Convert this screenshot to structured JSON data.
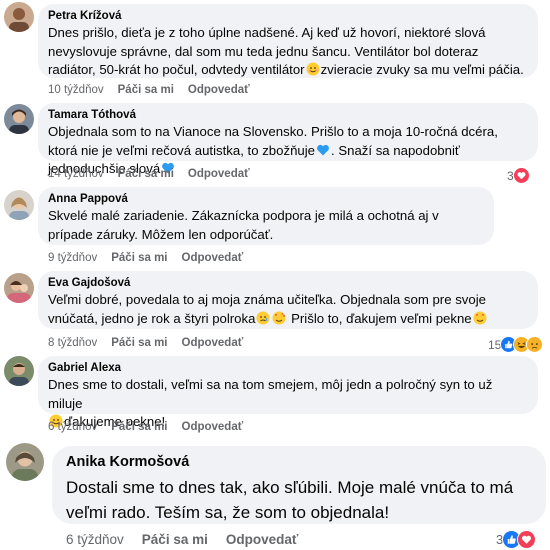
{
  "actions": {
    "like": "Páči sa mi",
    "reply": "Odpovedať"
  },
  "comments": [
    {
      "author": "Petra Krížová",
      "text_parts": [
        "Dnes prišlo, dieťa je z toho úplne nadšené. Aj keď už hovorí, niektoré slová nevyslovuje správne, dal som mu teda jednu šancu. Ventilátor bol doteraz radiátor, 50-krát ho počul, odvtedy ventilátor",
        "zvieracie zvuky sa mu veľmi páčia."
      ],
      "emojis": [
        "smiling-face-emoji"
      ],
      "age": "10 týždňov",
      "reaction_count": ""
    },
    {
      "author": "Tamara Tóthová",
      "text_parts": [
        "Objednala som to na Vianoce na Slovensko. Prišlo to a moja 10-ročná dcéra, ktorá nie je veľmi rečová autistka, to zbožňuje",
        ". Snaží sa napodobniť jednoduchšie slová"
      ],
      "emojis": [
        "blue-heart-emoji",
        "blue-heart-emoji"
      ],
      "age": "14 týždňov",
      "reaction_count": "3"
    },
    {
      "author": "Anna Pappová",
      "text_parts": [
        "Skvelé malé zariadenie. Zákaznícka podpora je milá a ochotná aj v prípade záruky. Môžem len odporúčať."
      ],
      "emojis": [],
      "age": "9 týždňov",
      "reaction_count": ""
    },
    {
      "author": "Eva Gajdošová",
      "text_parts": [
        "Veľmi dobré, povedala to aj moja známa učiteľka. Objednala som pre svoje vnúčatá, jedno je rok a štyri polroka",
        " Prišlo to, ďakujem veľmi pekne"
      ],
      "emojis": [
        "sad-face-emoji",
        "hearts-face-emoji",
        "hearts-face-emoji"
      ],
      "age": "8 týždňov",
      "reaction_count": "15"
    },
    {
      "author": "Gabriel Alexa",
      "text_parts": [
        "Dnes sme to dostali, veľmi sa na tom smejem, môj jedn a polročný syn to už miluje",
        "ďakujeme pekne!"
      ],
      "emojis": [
        "smiling-face-emoji"
      ],
      "age": "6 týždňov",
      "reaction_count": ""
    },
    {
      "author": "Anika Kormošová",
      "text_parts": [
        "Dostali sme to dnes tak, ako sľúbili. Moje malé vnúča to má veľmi rado. Teším sa, že som to objednala!"
      ],
      "emojis": [],
      "age": "6 týždňov",
      "reaction_count": "3"
    }
  ],
  "colors": {
    "bubble": "#f0f2f5",
    "meta_text": "#65676b",
    "like_blue": "#1877f2",
    "love_red": "#f33e58",
    "haha_yellow": "#f7b125"
  }
}
